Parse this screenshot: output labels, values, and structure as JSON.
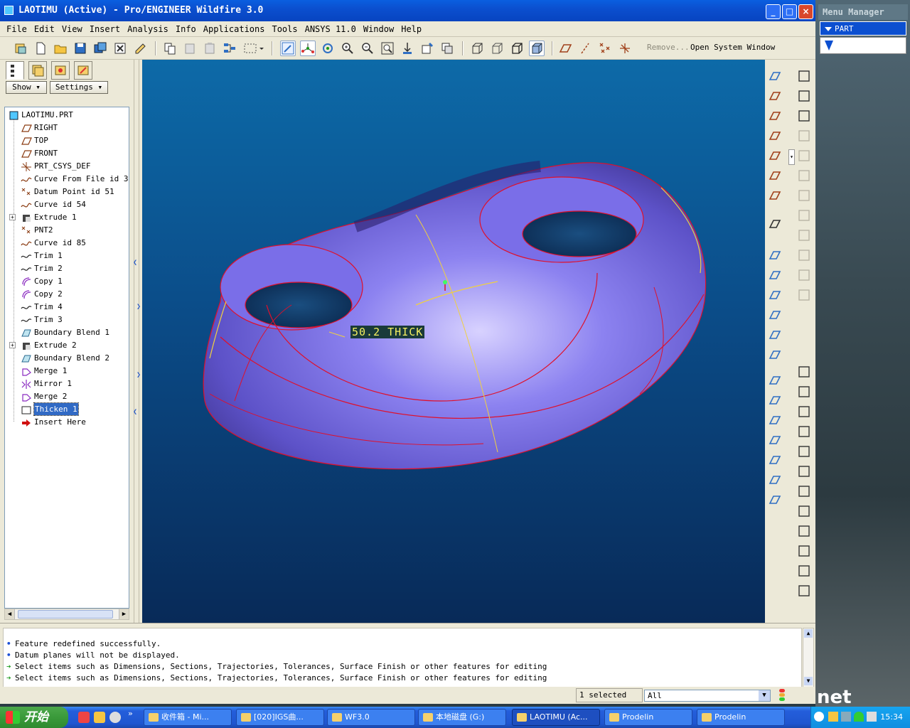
{
  "window": {
    "title": "LAOTIMU (Active) - Pro/ENGINEER Wildfire 3.0",
    "min": "_",
    "max": "□",
    "close": "×"
  },
  "menu": [
    "File",
    "Edit",
    "View",
    "Insert",
    "Analysis",
    "Info",
    "Applications",
    "Tools",
    "ANSYS 11.0",
    "Window",
    "Help"
  ],
  "toolbar": {
    "remove_label": "Remove...",
    "open_system_window": "Open System Window"
  },
  "navigator": {
    "show_label": "Show",
    "settings_label": "Settings",
    "tree": [
      {
        "label": "LAOTIMU.PRT",
        "icon": "part-icon",
        "expand": false
      },
      {
        "label": "RIGHT",
        "icon": "datum-plane-icon",
        "expand": false
      },
      {
        "label": "TOP",
        "icon": "datum-plane-icon",
        "expand": false
      },
      {
        "label": "FRONT",
        "icon": "datum-plane-icon",
        "expand": false
      },
      {
        "label": "PRT_CSYS_DEF",
        "icon": "csys-icon",
        "expand": false
      },
      {
        "label": "Curve From File id 39",
        "icon": "curve-icon",
        "expand": false
      },
      {
        "label": "Datum Point id 51",
        "icon": "datum-point-icon",
        "expand": false
      },
      {
        "label": "Curve id 54",
        "icon": "curve-icon",
        "expand": false
      },
      {
        "label": "Extrude 1",
        "icon": "extrude-icon",
        "expand": true
      },
      {
        "label": "PNT2",
        "icon": "datum-point-icon",
        "expand": false
      },
      {
        "label": "Curve id 85",
        "icon": "curve-icon",
        "expand": false
      },
      {
        "label": "Trim 1",
        "icon": "trim-icon",
        "expand": false
      },
      {
        "label": "Trim 2",
        "icon": "trim-icon",
        "expand": false
      },
      {
        "label": "Copy 1",
        "icon": "copy-icon",
        "expand": false
      },
      {
        "label": "Copy 2",
        "icon": "copy-icon",
        "expand": false
      },
      {
        "label": "Trim 4",
        "icon": "trim-icon",
        "expand": false
      },
      {
        "label": "Trim 3",
        "icon": "trim-icon",
        "expand": false
      },
      {
        "label": "Boundary Blend 1",
        "icon": "boundary-blend-icon",
        "expand": false
      },
      {
        "label": "Extrude 2",
        "icon": "extrude-icon",
        "expand": true
      },
      {
        "label": "Boundary Blend 2",
        "icon": "boundary-blend-icon",
        "expand": false
      },
      {
        "label": "Merge 1",
        "icon": "merge-icon",
        "expand": false
      },
      {
        "label": "Mirror 1",
        "icon": "mirror-icon",
        "expand": false
      },
      {
        "label": "Merge 2",
        "icon": "merge-icon",
        "expand": false
      },
      {
        "label": "Thicken 1",
        "icon": "thicken-icon",
        "expand": false,
        "selected": true
      },
      {
        "label": "Insert Here",
        "icon": "insert-here-icon",
        "expand": false
      }
    ]
  },
  "viewport": {
    "dimension_label": "50.2 THICK",
    "surface_color": "#7a6ee8",
    "edge_color": "#e0102a",
    "curve_color": "#f0d040"
  },
  "messages": [
    {
      "kind": "info",
      "text": "Feature redefined successfully."
    },
    {
      "kind": "info",
      "text": "Datum planes will not be displayed."
    },
    {
      "kind": "prompt",
      "text": "Select items such as Dimensions, Sections, Trajectories, Tolerances, Surface Finish or other features for editing"
    },
    {
      "kind": "prompt",
      "text": "Select items such as Dimensions, Sections, Trajectories, Tolerances, Surface Finish or other features for editing"
    }
  ],
  "status": {
    "selected": "1 selected",
    "filter": "All"
  },
  "menu_manager": {
    "title": "Menu Manager",
    "part": "PART"
  },
  "watermark": "net",
  "taskbar": {
    "start": "开始",
    "tasks": [
      {
        "label": "收件箱 - Mi...",
        "active": false
      },
      {
        "label": "[020]IGS曲...",
        "active": false
      },
      {
        "label": "WF3.0",
        "active": false
      },
      {
        "label": "本地磁盘 (G:)",
        "active": false
      },
      {
        "label": "LAOTIMU (Ac...",
        "active": true
      },
      {
        "label": "Prodelin",
        "active": false
      },
      {
        "label": "Prodelin",
        "active": false
      }
    ],
    "clock": "15:34"
  }
}
